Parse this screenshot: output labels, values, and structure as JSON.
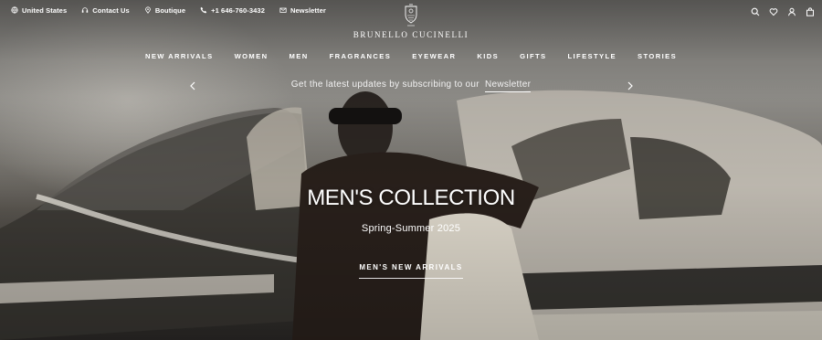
{
  "utility": {
    "items": [
      {
        "label": "United States",
        "icon": "globe-icon"
      },
      {
        "label": "Contact Us",
        "icon": "headset-icon"
      },
      {
        "label": "Boutique",
        "icon": "location-pin-icon"
      },
      {
        "label": "+1 646-760-3432",
        "icon": "phone-icon"
      },
      {
        "label": "Newsletter",
        "icon": "envelope-icon"
      }
    ],
    "actions": [
      "search-icon",
      "heart-icon",
      "user-icon",
      "bag-icon"
    ]
  },
  "logo": {
    "brand": "BRUNELLO CUCINELLI",
    "icon": "crest-icon"
  },
  "nav": [
    "NEW ARRIVALS",
    "WOMEN",
    "MEN",
    "FRAGRANCES",
    "EYEWEAR",
    "KIDS",
    "GIFTS",
    "LIFESTYLE",
    "STORIES"
  ],
  "promo": {
    "text": "Get the latest updates by subscribing to our",
    "link": "Newsletter"
  },
  "hero": {
    "title": "MEN'S COLLECTION",
    "subtitle": "Spring-Summer 2025",
    "cta": "MEN'S NEW ARRIVALS"
  },
  "colors": {
    "text": "#ffffff",
    "background": "#7d7a74"
  }
}
